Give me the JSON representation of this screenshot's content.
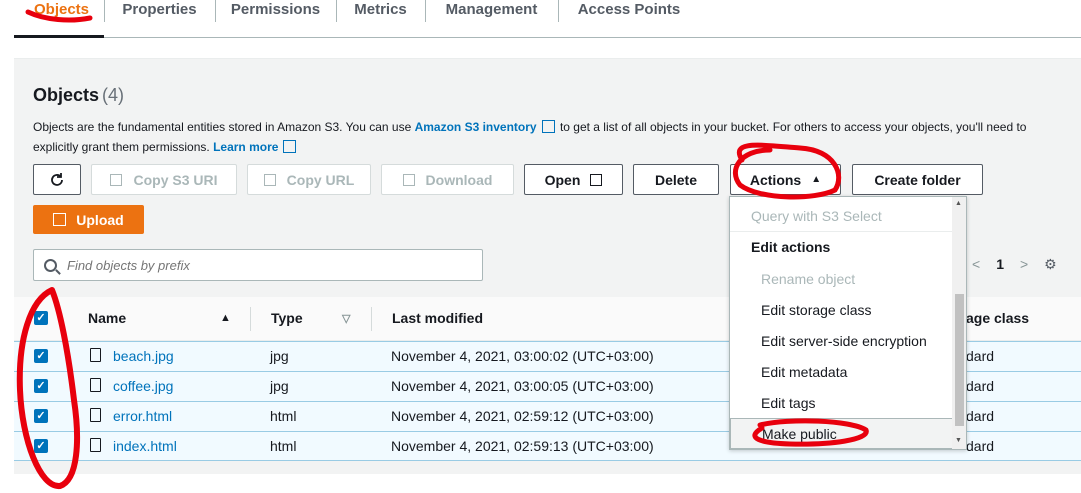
{
  "tabs": [
    {
      "label": "Objects",
      "active": true
    },
    {
      "label": "Properties"
    },
    {
      "label": "Permissions"
    },
    {
      "label": "Metrics"
    },
    {
      "label": "Management"
    },
    {
      "label": "Access Points"
    }
  ],
  "panel": {
    "title": "Objects",
    "count": "(4)",
    "desc_part1": "Objects are the fundamental entities stored in Amazon S3. You can use ",
    "desc_link1": "Amazon S3 inventory",
    "desc_part2": " to get a list of all objects in your bucket. For others to access your objects, you'll need to explicitly grant them permissions. ",
    "desc_link2": "Learn more"
  },
  "toolbar": {
    "copy_uri": "Copy S3 URI",
    "copy_url": "Copy URL",
    "download": "Download",
    "open": "Open",
    "delete": "Delete",
    "actions": "Actions",
    "create_folder": "Create folder",
    "upload": "Upload"
  },
  "search": {
    "placeholder": "Find objects by prefix"
  },
  "pager": {
    "current": "1"
  },
  "table": {
    "headers": {
      "name": "Name",
      "type": "Type",
      "last_modified": "Last modified",
      "storage_class": "age class"
    },
    "rows": [
      {
        "name": "beach.jpg",
        "type": "jpg",
        "modified": "November 4, 2021, 03:00:02 (UTC+03:00)",
        "storage": "dard"
      },
      {
        "name": "coffee.jpg",
        "type": "jpg",
        "modified": "November 4, 2021, 03:00:05 (UTC+03:00)",
        "storage": "dard"
      },
      {
        "name": "error.html",
        "type": "html",
        "modified": "November 4, 2021, 02:59:12 (UTC+03:00)",
        "storage": "dard"
      },
      {
        "name": "index.html",
        "type": "html",
        "modified": "November 4, 2021, 02:59:13 (UTC+03:00)",
        "storage": "dard"
      }
    ]
  },
  "actions_menu": {
    "query": "Query with S3 Select",
    "group": "Edit actions",
    "rename": "Rename object",
    "storage_class": "Edit storage class",
    "encryption": "Edit server-side encryption",
    "metadata": "Edit metadata",
    "tags": "Edit tags",
    "make_public": "Make public"
  },
  "colors": {
    "accent": "#ec7211",
    "link": "#0073bb",
    "annotation": "#e8000d"
  }
}
